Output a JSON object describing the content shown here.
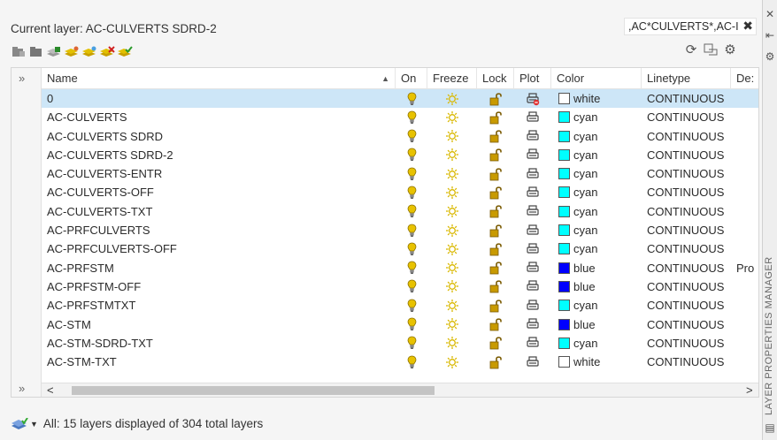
{
  "current_layer": "Current layer: AC-CULVERTS SDRD-2",
  "filter_text": ",AC*CULVERTS*,AC-I",
  "filter_close": "✖",
  "side_title": "LAYER PROPERTIES MANAGER",
  "expand_glyph": "»",
  "columns": {
    "name": "Name",
    "on": "On",
    "freeze": "Freeze",
    "lock": "Lock",
    "plot": "Plot",
    "color": "Color",
    "linetype": "Linetype",
    "description": "De:"
  },
  "rows": [
    {
      "name": "0",
      "color": "white",
      "color_hex": "#ffffff",
      "linetype": "CONTINUOUS",
      "desc": "",
      "plot_icon": "no-plot-icon"
    },
    {
      "name": "AC-CULVERTS",
      "color": "cyan",
      "color_hex": "#00ffff",
      "linetype": "CONTINUOUS",
      "desc": ""
    },
    {
      "name": "AC-CULVERTS SDRD",
      "color": "cyan",
      "color_hex": "#00ffff",
      "linetype": "CONTINUOUS",
      "desc": ""
    },
    {
      "name": "AC-CULVERTS SDRD-2",
      "color": "cyan",
      "color_hex": "#00ffff",
      "linetype": "CONTINUOUS",
      "desc": ""
    },
    {
      "name": "AC-CULVERTS-ENTR",
      "color": "cyan",
      "color_hex": "#00ffff",
      "linetype": "CONTINUOUS",
      "desc": ""
    },
    {
      "name": "AC-CULVERTS-OFF",
      "color": "cyan",
      "color_hex": "#00ffff",
      "linetype": "CONTINUOUS",
      "desc": ""
    },
    {
      "name": "AC-CULVERTS-TXT",
      "color": "cyan",
      "color_hex": "#00ffff",
      "linetype": "CONTINUOUS",
      "desc": ""
    },
    {
      "name": "AC-PRFCULVERTS",
      "color": "cyan",
      "color_hex": "#00ffff",
      "linetype": "CONTINUOUS",
      "desc": ""
    },
    {
      "name": "AC-PRFCULVERTS-OFF",
      "color": "cyan",
      "color_hex": "#00ffff",
      "linetype": "CONTINUOUS",
      "desc": ""
    },
    {
      "name": "AC-PRFSTM",
      "color": "blue",
      "color_hex": "#0000ff",
      "linetype": "CONTINUOUS",
      "desc": "Pro"
    },
    {
      "name": "AC-PRFSTM-OFF",
      "color": "blue",
      "color_hex": "#0000ff",
      "linetype": "CONTINUOUS",
      "desc": ""
    },
    {
      "name": "AC-PRFSTMTXT",
      "color": "cyan",
      "color_hex": "#00ffff",
      "linetype": "CONTINUOUS",
      "desc": ""
    },
    {
      "name": "AC-STM",
      "color": "blue",
      "color_hex": "#0000ff",
      "linetype": "CONTINUOUS",
      "desc": ""
    },
    {
      "name": "AC-STM-SDRD-TXT",
      "color": "cyan",
      "color_hex": "#00ffff",
      "linetype": "CONTINUOUS",
      "desc": ""
    },
    {
      "name": "AC-STM-TXT",
      "color": "white",
      "color_hex": "#ffffff",
      "linetype": "CONTINUOUS",
      "desc": ""
    }
  ],
  "selected_row": 0,
  "status": "All: 15 layers displayed of 304 total layers",
  "scroll_left": "<",
  "scroll_right": ">",
  "colors": {
    "selection": "#cde6f7",
    "bulb_on": "#e8c200",
    "sun": "#d9b800",
    "lock": "#c89a00",
    "plot_no": "#e03030"
  }
}
